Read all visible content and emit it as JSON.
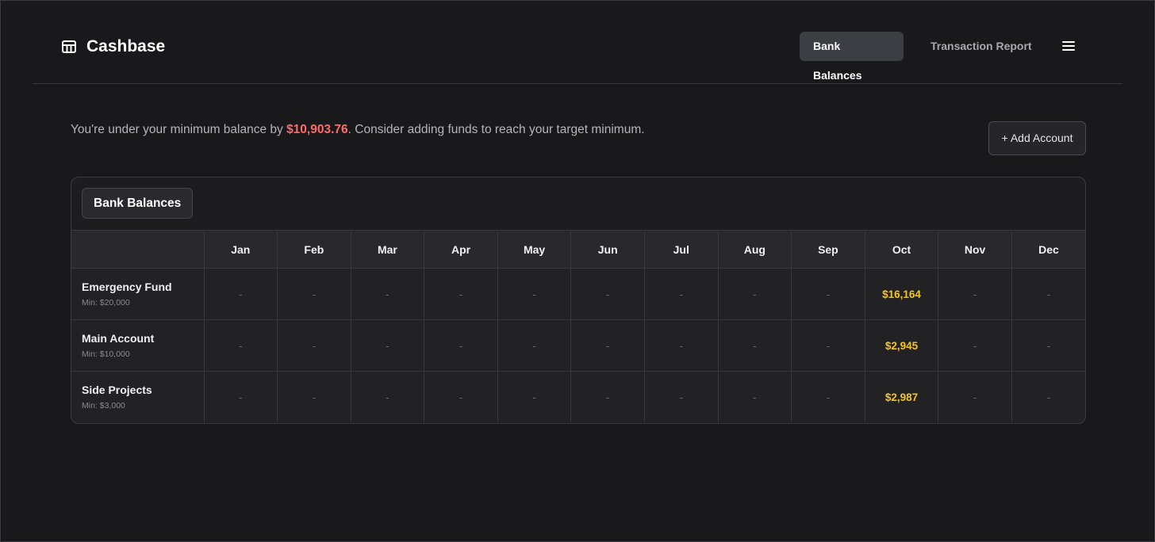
{
  "app": {
    "name": "Cashbase",
    "icon": "table-icon"
  },
  "nav": {
    "tabs": [
      {
        "label": "Bank Balances",
        "active": true
      },
      {
        "label": "Transaction Report",
        "active": false
      }
    ],
    "menu_icon": "hamburger-menu-icon"
  },
  "notice": {
    "prefix": "You're under your minimum balance by ",
    "amount": "$10,903.76",
    "suffix": ". Consider adding funds to reach your target minimum."
  },
  "add_account_label": "+ Add Account",
  "panel": {
    "title": "Bank Balances",
    "months": [
      "Jan",
      "Feb",
      "Mar",
      "Apr",
      "May",
      "Jun",
      "Jul",
      "Aug",
      "Sep",
      "Oct",
      "Nov",
      "Dec"
    ],
    "rows": [
      {
        "name": "Emergency Fund",
        "min": "Min: $20,000",
        "values": [
          "-",
          "-",
          "-",
          "-",
          "-",
          "-",
          "-",
          "-",
          "-",
          "$16,164",
          "-",
          "-"
        ]
      },
      {
        "name": "Main Account",
        "min": "Min: $10,000",
        "values": [
          "-",
          "-",
          "-",
          "-",
          "-",
          "-",
          "-",
          "-",
          "-",
          "$2,945",
          "-",
          "-"
        ]
      },
      {
        "name": "Side Projects",
        "min": "Min: $3,000",
        "values": [
          "-",
          "-",
          "-",
          "-",
          "-",
          "-",
          "-",
          "-",
          "-",
          "$2,987",
          "-",
          "-"
        ]
      }
    ]
  },
  "colors": {
    "background": "#19191b",
    "warning_amount": "#ff6b6b",
    "balance_value": "#f5c518",
    "active_tab": "#3d3d44"
  }
}
